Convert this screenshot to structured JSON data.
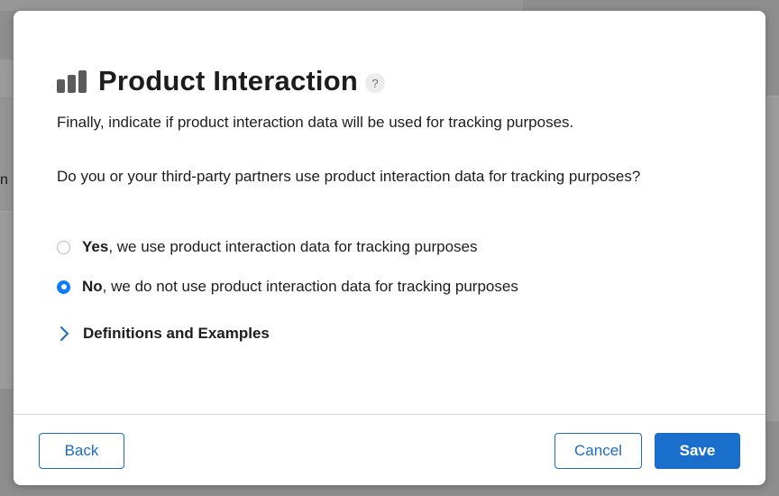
{
  "background": {
    "partial_text": "n"
  },
  "dialog": {
    "title": "Product Interaction",
    "title_icon": "bar-chart-icon",
    "help_glyph": "?",
    "intro": "Finally, indicate if product interaction data will be used for tracking purposes.",
    "question": "Do you or your third-party partners use product interaction data for tracking purposes?",
    "options": [
      {
        "strong": "Yes",
        "rest": ", we use product interaction data for tracking purposes",
        "selected": false
      },
      {
        "strong": "No",
        "rest": ", we do not use product interaction data for tracking purposes",
        "selected": true
      }
    ],
    "disclosure_label": "Definitions and Examples"
  },
  "footer": {
    "back_label": "Back",
    "cancel_label": "Cancel",
    "save_label": "Save"
  },
  "colors": {
    "accent": "#1b6fcc",
    "radio_selected": "#0a7aff",
    "text": "#1d1d1f"
  }
}
